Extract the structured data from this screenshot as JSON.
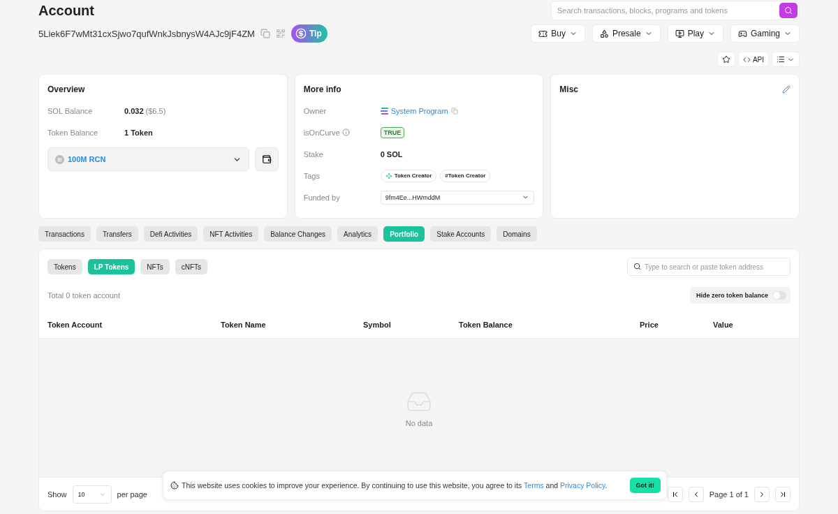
{
  "page": {
    "title": "Account"
  },
  "search": {
    "placeholder": "Search transactions, blocks, programs and tokens"
  },
  "address": "5Liek6F7wMt31cxSjwo7qufWnkJsbnysW4AJc9jF4ZM",
  "tip_button": "Tip",
  "menus": [
    {
      "label": "Buy",
      "kind": "buy"
    },
    {
      "label": "Presale",
      "kind": "presale"
    },
    {
      "label": "Play",
      "kind": "play"
    },
    {
      "label": "Gaming",
      "kind": "gaming"
    }
  ],
  "tools": {
    "api": "API"
  },
  "overview": {
    "title": "Overview",
    "rows": [
      {
        "label": "SOL Balance",
        "value": "0.032",
        "note": "($6.5)"
      },
      {
        "label": "Token Balance",
        "value": "1 Token"
      }
    ],
    "token_select": "100M RCN"
  },
  "more_info": {
    "title": "More info",
    "owner": {
      "label": "Owner",
      "value": "System Program"
    },
    "curve": {
      "label": "isOnCurve",
      "value": "TRUE"
    },
    "stake": {
      "label": "Stake",
      "value": "0 SOL"
    },
    "tags": {
      "label": "Tags",
      "items": [
        {
          "label": "Token Creator",
          "kind": "icon"
        },
        {
          "label": "#Token Creator",
          "kind": "plain"
        }
      ]
    },
    "funded_by": {
      "label": "Funded by",
      "value": "9fm4Ee...HWmddM"
    }
  },
  "misc": {
    "title": "Misc"
  },
  "tabs": [
    {
      "label": "Transactions",
      "selected": false
    },
    {
      "label": "Transfers",
      "selected": false
    },
    {
      "label": "Defi Activities",
      "selected": false
    },
    {
      "label": "NFT Activities",
      "selected": false
    },
    {
      "label": "Balance Changes",
      "selected": false
    },
    {
      "label": "Analytics",
      "selected": false
    },
    {
      "label": "Portfolio",
      "selected": true
    },
    {
      "label": "Stake Accounts",
      "selected": false
    },
    {
      "label": "Domains",
      "selected": false
    }
  ],
  "subtabs": [
    {
      "label": "Tokens",
      "selected": false
    },
    {
      "label": "LP Tokens",
      "selected": true
    },
    {
      "label": "NFTs",
      "selected": false
    },
    {
      "label": "cNFTs",
      "selected": false
    }
  ],
  "token_search": {
    "placeholder": "Type to search or paste token address"
  },
  "total": "Total 0 token account",
  "hide_zero": {
    "label": "Hide zero token balance",
    "on": false
  },
  "table": {
    "columns": [
      "Token Account",
      "Token Name",
      "Symbol",
      "Token Balance",
      "Price",
      "Value"
    ],
    "empty": "No data"
  },
  "pagination": {
    "show": "Show",
    "page_size": "10",
    "per_page": "per page",
    "page": "Page 1 of 1"
  },
  "cookie": {
    "text": "This website uses cookies to improve your experience. By continuing to use this website, you agree to its ",
    "terms": "Terms",
    "and": " and ",
    "privacy": "Privacy Policy",
    "end": ".",
    "button": "Got it!"
  }
}
